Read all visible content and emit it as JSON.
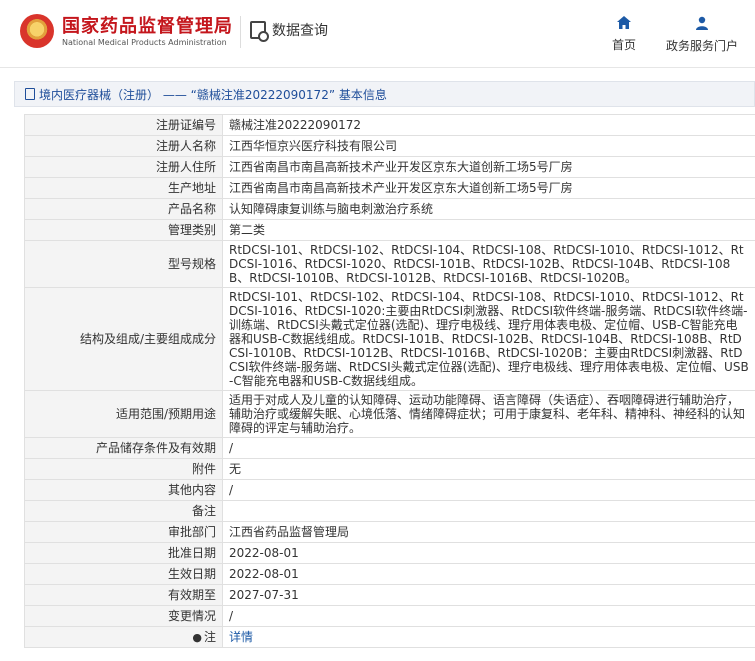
{
  "header": {
    "brand_cn": "国家药品监督管理局",
    "brand_en": "National Medical Products Administration",
    "data_query": "数据查询",
    "nav": [
      {
        "label": "首页",
        "icon": "home-icon"
      },
      {
        "label": "政务服务门户",
        "icon": "user-icon"
      }
    ]
  },
  "title_bar": {
    "text": "境内医疗器械（注册） —— “赣械注准20222090172” 基本信息"
  },
  "details": [
    {
      "label": "注册证编号",
      "value": "赣械注准20222090172"
    },
    {
      "label": "注册人名称",
      "value": "江西华恒京兴医疗科技有限公司"
    },
    {
      "label": "注册人住所",
      "value": "江西省南昌市南昌高新技术产业开发区京东大道创新工场5号厂房"
    },
    {
      "label": "生产地址",
      "value": "江西省南昌市南昌高新技术产业开发区京东大道创新工场5号厂房"
    },
    {
      "label": "产品名称",
      "value": "认知障碍康复训练与脑电刺激治疗系统"
    },
    {
      "label": "管理类别",
      "value": "第二类"
    },
    {
      "label": "型号规格",
      "value": "RtDCSI-101、RtDCSI-102、RtDCSI-104、RtDCSI-108、RtDCSI-1010、RtDCSI-1012、RtDCSI-1016、RtDCSI-1020、RtDCSI-101B、RtDCSI-102B、RtDCSI-104B、RtDCSI-108B、RtDCSI-1010B、RtDCSI-1012B、RtDCSI-1016B、RtDCSI-1020B。"
    },
    {
      "label": "结构及组成/主要组成成分",
      "value": "RtDCSI-101、RtDCSI-102、RtDCSI-104、RtDCSI-108、RtDCSI-1010、RtDCSI-1012、RtDCSI-1016、RtDCSI-1020:主要由RtDCSI刺激器、RtDCSI软件终端-服务端、RtDCSI软件终端-训练端、RtDCSI头戴式定位器(选配)、理疗电极线、理疗用体表电极、定位帽、USB-C智能充电器和USB-C数据线组成。RtDCSI-101B、RtDCSI-102B、RtDCSI-104B、RtDCSI-108B、RtDCSI-1010B、RtDCSI-1012B、RtDCSI-1016B、RtDCSI-1020B：主要由RtDCSI刺激器、RtDCSI软件终端-服务端、RtDCSI头戴式定位器(选配)、理疗电极线、理疗用体表电极、定位帽、USB-C智能充电器和USB-C数据线组成。"
    },
    {
      "label": "适用范围/预期用途",
      "value": "适用于对成人及儿童的认知障碍、运动功能障碍、语言障碍（失语症）、吞咽障碍进行辅助治疗，辅助治疗或缓解失眠、心境低落、情绪障碍症状；可用于康复科、老年科、精神科、神经科的认知障碍的评定与辅助治疗。"
    },
    {
      "label": "产品储存条件及有效期",
      "value": "/"
    },
    {
      "label": "附件",
      "value": "无"
    },
    {
      "label": "其他内容",
      "value": "/"
    },
    {
      "label": "备注",
      "value": ""
    },
    {
      "label": "审批部门",
      "value": "江西省药品监督管理局"
    },
    {
      "label": "批准日期",
      "value": "2022-08-01"
    },
    {
      "label": "生效日期",
      "value": "2022-08-01"
    },
    {
      "label": "有效期至",
      "value": "2027-07-31"
    },
    {
      "label": "变更情况",
      "value": "/"
    }
  ],
  "note_row": {
    "label": "注",
    "link": "详情"
  }
}
